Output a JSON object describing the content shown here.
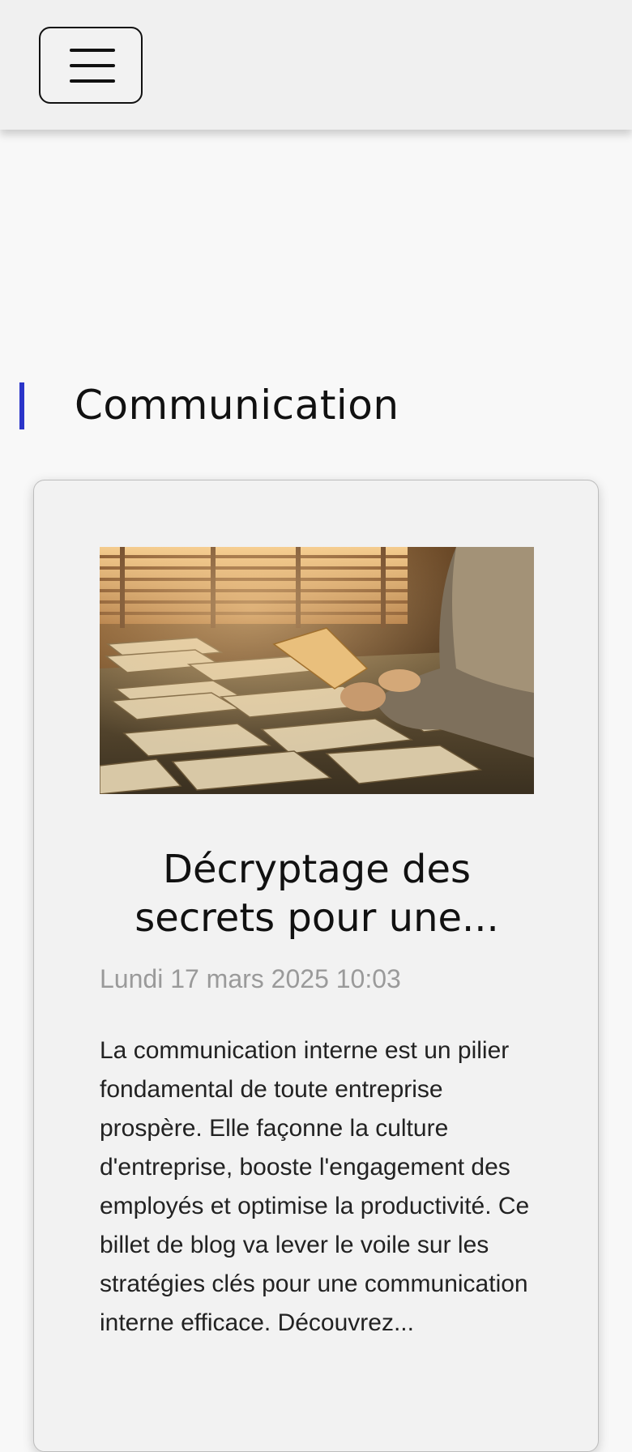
{
  "header": {
    "menu_icon": "hamburger-menu-icon"
  },
  "section": {
    "title": "Communication",
    "accent_color": "#2b35c9"
  },
  "article": {
    "image_alt": "",
    "title": "Décryptage des secrets pour une...",
    "date": "Lundi 17 mars 2025 10:03",
    "excerpt": "La communication interne est un pilier fondamental de toute entreprise prospère. Elle façonne la culture d'entreprise, booste l'engagement des employés et optimise la productivité. Ce billet de blog va lever le voile sur les stratégies clés pour une communication interne efficace. Découvrez..."
  }
}
